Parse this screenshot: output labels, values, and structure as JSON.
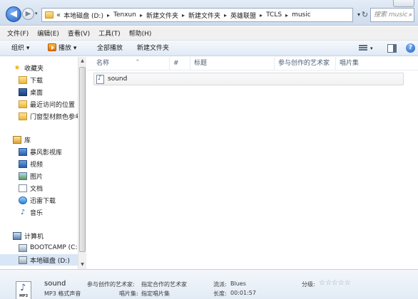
{
  "address": {
    "prefix": "«",
    "crumbs": [
      "本地磁盘 (D:)",
      "Tenxun",
      "新建文件夹",
      "新建文件夹",
      "英雄联盟",
      "TCLS",
      "music"
    ],
    "search_placeholder": "搜索 music"
  },
  "menu": [
    "文件(F)",
    "编辑(E)",
    "查看(V)",
    "工具(T)",
    "帮助(H)"
  ],
  "toolbar": {
    "organize": "组织 ▾",
    "play": "播放 ▾",
    "play_all": "全部播放",
    "new_folder": "新建文件夹"
  },
  "nav": {
    "favorites": "收藏夹",
    "fav_items": [
      "下载",
      "桌面",
      "最近访问的位置",
      "门窗型材颜色参考"
    ],
    "library": "库",
    "lib_items": [
      "暴风影视库",
      "视频",
      "图片",
      "文档",
      "迅雷下载",
      "音乐"
    ],
    "computer": "计算机",
    "drives": [
      "BOOTCAMP (C:)",
      "本地磁盘 (D:)"
    ]
  },
  "columns": [
    "名称",
    "#",
    "标题",
    "参与创作的艺术家",
    "唱片集"
  ],
  "files": [
    {
      "name": "sound"
    }
  ],
  "details": {
    "name": "sound",
    "type": "MP3 格式声音",
    "artist_label": "参与创作的艺术家:",
    "artist_value": "指定合作的艺术家",
    "album_label": "唱片集:",
    "album_value": "指定唱片集",
    "genre_label": "流派:",
    "genre_value": "Blues",
    "length_label": "长度:",
    "length_value": "00:01:57",
    "rating_label": "分级:",
    "rating_stars": "☆☆☆☆☆",
    "icon_text": "MP3"
  }
}
